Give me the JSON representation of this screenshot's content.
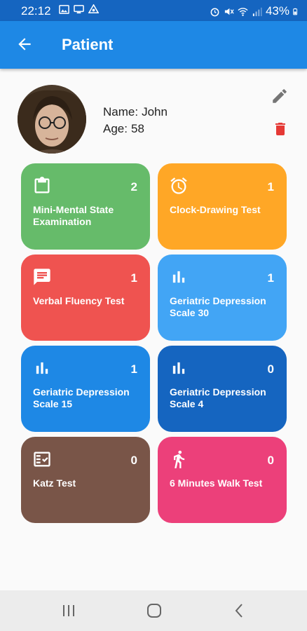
{
  "status": {
    "time": "22:12",
    "battery": "43%"
  },
  "header": {
    "title": "Patient"
  },
  "patient": {
    "name_label": "Name:",
    "name": "John",
    "age_label": "Age:",
    "age": "58"
  },
  "tests": [
    {
      "label": "Mini-Mental State Examination",
      "count": "2",
      "color": "#66bb6a",
      "icon": "clipboard-icon"
    },
    {
      "label": "Clock-Drawing Test",
      "count": "1",
      "color": "#ffa726",
      "icon": "alarm-clock-icon"
    },
    {
      "label": "Verbal Fluency Test",
      "count": "1",
      "color": "#ef5350",
      "icon": "chat-icon"
    },
    {
      "label": "Geriatric Depression Scale 30",
      "count": "1",
      "color": "#42a5f5",
      "icon": "bar-chart-icon"
    },
    {
      "label": "Geriatric Depression Scale 15",
      "count": "1",
      "color": "#1e88e5",
      "icon": "bar-chart-icon"
    },
    {
      "label": "Geriatric Depression Scale 4",
      "count": "0",
      "color": "#1565c0",
      "icon": "bar-chart-icon"
    },
    {
      "label": "Katz Test",
      "count": "0",
      "color": "#795548",
      "icon": "checklist-icon"
    },
    {
      "label": "6 Minutes Walk Test",
      "count": "0",
      "color": "#ec407a",
      "icon": "walking-person-icon"
    }
  ],
  "colors": {
    "appbar": "#1e88e5",
    "statusbar": "#1565c0",
    "delete": "#e53935",
    "edit": "#757575"
  }
}
